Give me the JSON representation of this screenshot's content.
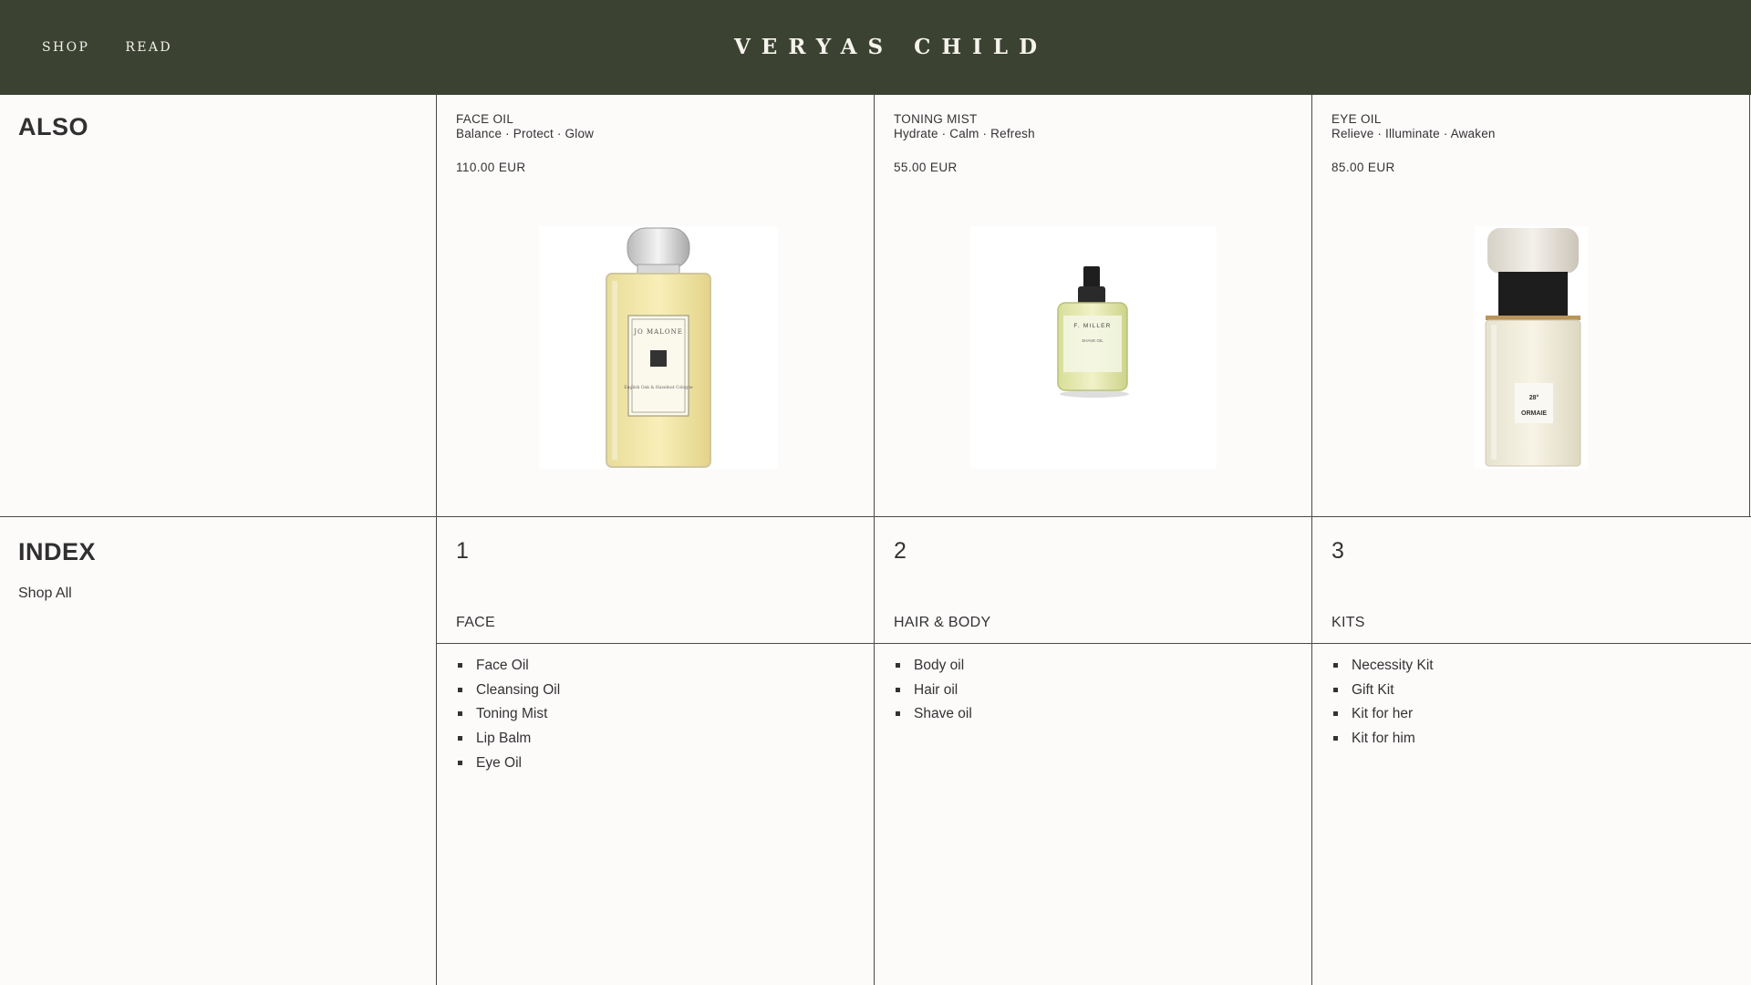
{
  "header": {
    "nav": [
      {
        "label": "SHOP"
      },
      {
        "label": "READ"
      }
    ],
    "brand": "VERYAS CHILD",
    "background": "#3b4232"
  },
  "also": {
    "title": "ALSO",
    "products": [
      {
        "name": "FACE OIL",
        "tagline": "Balance · Protect · Glow",
        "price": "110.00 EUR",
        "image_label": "JO MALONE",
        "image_sublabel": "English Oak & Hazelnut Cologne",
        "icon": "amber-cologne-bottle"
      },
      {
        "name": "TONING MIST",
        "tagline": "Hydrate · Calm · Refresh",
        "price": "55.00 EUR",
        "image_label": "F. MILLER",
        "image_sublabel": "SHAVE OIL",
        "icon": "green-spray-bottle"
      },
      {
        "name": "EYE OIL",
        "tagline": "Relieve · Illuminate · Awaken",
        "price": "85.00 EUR",
        "image_label": "ORMAIE",
        "image_sublabel": "28°",
        "icon": "ormaie-bottle"
      }
    ]
  },
  "index": {
    "title": "INDEX",
    "shop_all": "Shop All",
    "categories": [
      {
        "number": "1",
        "name": "FACE",
        "items": [
          "Face Oil",
          "Cleansing Oil",
          "Toning Mist",
          "Lip Balm",
          "Eye Oil"
        ]
      },
      {
        "number": "2",
        "name": "HAIR & BODY",
        "items": [
          "Body oil",
          "Hair oil",
          "Shave oil"
        ]
      },
      {
        "number": "3",
        "name": "KITS",
        "items": [
          "Necessity Kit",
          "Gift Kit",
          "Kit for her",
          "Kit for him"
        ]
      }
    ]
  }
}
